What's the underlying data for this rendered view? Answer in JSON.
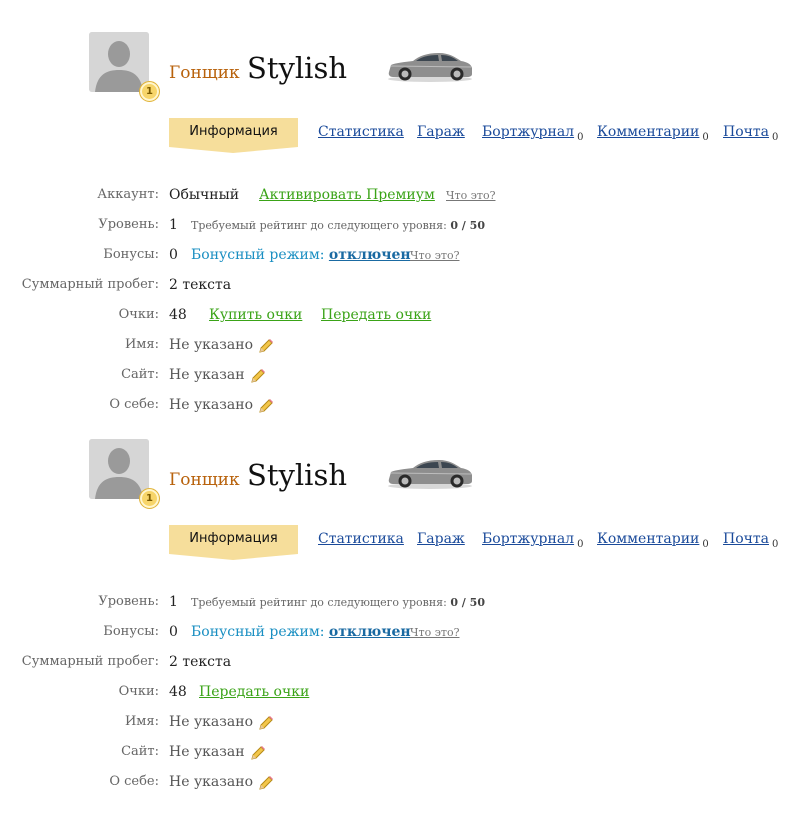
{
  "profiles": [
    {
      "level_badge": "1",
      "role_label": "Гонщик",
      "username": "Stylish",
      "tabs": {
        "info": "Информация",
        "stats": "Статистика",
        "garage": "Гараж",
        "logbook": "Бортжурнал",
        "logbook_count": "0",
        "comments": "Комментарии",
        "comments_count": "0",
        "mail": "Почта",
        "mail_count": "0"
      },
      "account": {
        "label": "Аккаунт:",
        "value": "Обычный",
        "premium_link": "Активировать Премиум",
        "what_link": "Что это?"
      },
      "level": {
        "label": "Уровень:",
        "value": "1",
        "note": "Требуемый рейтинг до следующего уровня:",
        "progress": "0 / 50"
      },
      "bonuses": {
        "label": "Бонусы:",
        "value": "0",
        "mode_text": "Бонусный режим:",
        "mode_state": "отключен",
        "what_link": "Что это?"
      },
      "mileage": {
        "label": "Суммарный пробег:",
        "value": "2 текста"
      },
      "points": {
        "label": "Очки:",
        "value": "48",
        "buy_link": "Купить очки",
        "transfer_link": "Передать очки"
      },
      "name": {
        "label": "Имя:",
        "value": "Не указано"
      },
      "site": {
        "label": "Сайт:",
        "value": "Не указан"
      },
      "about": {
        "label": "О себе:",
        "value": "Не указано"
      }
    },
    {
      "level_badge": "1",
      "role_label": "Гонщик",
      "username": "Stylish",
      "tabs": {
        "info": "Информация",
        "stats": "Статистика",
        "garage": "Гараж",
        "logbook": "Бортжурнал",
        "logbook_count": "0",
        "comments": "Комментарии",
        "comments_count": "0",
        "mail": "Почта",
        "mail_count": "0"
      },
      "level": {
        "label": "Уровень:",
        "value": "1",
        "note": "Требуемый рейтинг до следующего уровня:",
        "progress": "0 / 50"
      },
      "bonuses": {
        "label": "Бонусы:",
        "value": "0",
        "mode_text": "Бонусный режим:",
        "mode_state": "отключен",
        "what_link": "Что это?"
      },
      "mileage": {
        "label": "Суммарный пробег:",
        "value": "2 текста"
      },
      "points": {
        "label": "Очки:",
        "value": "48",
        "transfer_link": "Передать очки"
      },
      "name": {
        "label": "Имя:",
        "value": "Не указано"
      },
      "site": {
        "label": "Сайт:",
        "value": "Не указан"
      },
      "about": {
        "label": "О себе:",
        "value": "Не указано"
      }
    }
  ],
  "colors": {
    "role_label": "#b8620c",
    "tab_link": "#1a4a9a",
    "active_tab_bg": "#f6de9b",
    "green_link": "#3aa317",
    "bonus_blue": "#1a8fc2"
  }
}
